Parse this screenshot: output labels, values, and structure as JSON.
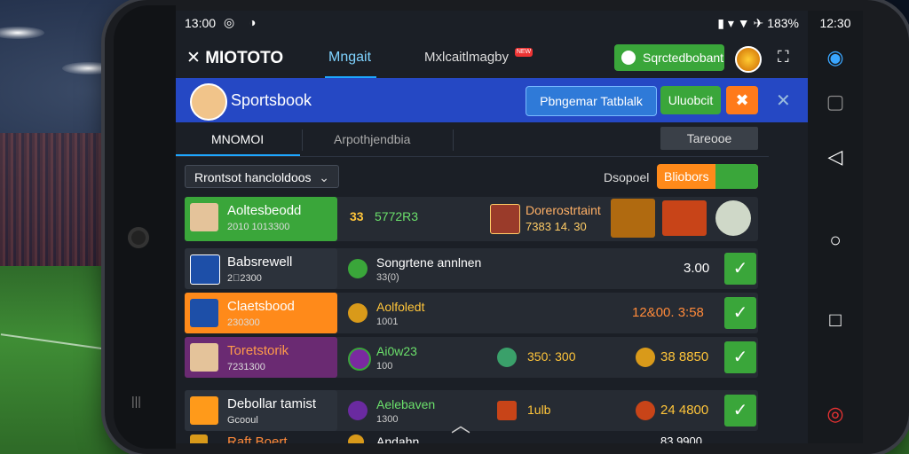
{
  "status_bar": {
    "time_left": "13:00",
    "time_right": "12:30",
    "battery": "183%",
    "icons_left": "◎ ◑",
    "signal": "▮ ▾ ▼ ✈"
  },
  "app_bar": {
    "brand": "✕ MIOTOTO",
    "nav": [
      "Mngait",
      "Mxlcaitlmagby"
    ],
    "nav_badge": "NEW",
    "green_button": "Sqrctedbobant"
  },
  "sportsbook_bar": {
    "title": "Sportsbook",
    "button_primary": "Pbngemar Tatblalk",
    "button_green": "Uluobcit"
  },
  "tabs": {
    "tab1": "MNOMOI",
    "tab2": "Arpothjendbia",
    "tab3": "Tareooe"
  },
  "filter": {
    "dropdown": "Rrontsot hancloldoos",
    "deposit_label": "Dsopoel",
    "toggle_label": "Bliobors"
  },
  "rows": [
    {
      "name": "Aoltesbeodd",
      "sub": "2010 1013300",
      "mid": "5772R3",
      "mid_prefix": "33",
      "event": "Dorerostrtaint",
      "event_odds": "7383 14. 30",
      "right_value": "0",
      "accent": "#3aa63a"
    },
    {
      "name": "Babsrewell",
      "sub": "2⃣2300",
      "mid": "Songrtene annlnen",
      "mid_sub": "33(0)",
      "odds": "3.00",
      "accent": "#262b33"
    },
    {
      "name": "Claetsbood",
      "sub": "230300",
      "mid": "Aolfoledt",
      "mid_sub": "1001",
      "odds": "12&00. 3:58",
      "accent": "#ff8a1a"
    },
    {
      "name": "Toretstorik",
      "sub": "7231300",
      "mid": "Ai0w23",
      "mid_sub": "100",
      "odds_mid": "350: 300",
      "odds": "38 8850",
      "accent": "#6a2a72"
    },
    {
      "name": "Debollar tamist",
      "sub": "Gcooul",
      "mid": "Aelebaven",
      "mid_sub": "1300",
      "odds_mid": "1ulb",
      "odds": "24 4800",
      "accent": "#262b33"
    },
    {
      "name": "Raft Boert",
      "mid": "Andahn",
      "odds": "83 9900"
    }
  ],
  "colors": {
    "primary_blue": "#2548c4",
    "accent_green": "#3aa63a",
    "accent_orange": "#ff8a1a",
    "bg": "#1b1f26"
  }
}
